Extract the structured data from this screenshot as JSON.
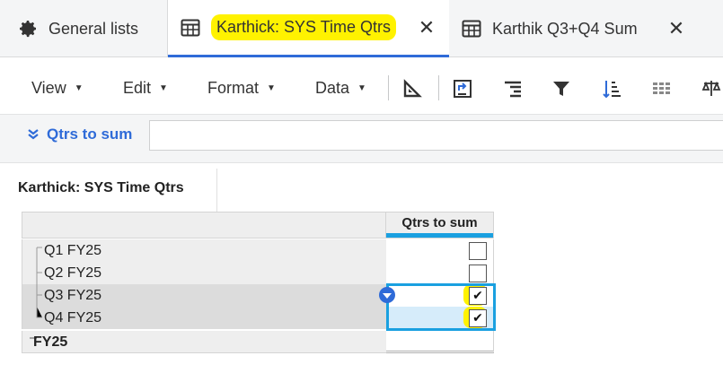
{
  "tabs": [
    {
      "label": "General lists",
      "icon": "gear-icon"
    },
    {
      "label": "Karthick: SYS Time Qtrs",
      "icon": "table-icon",
      "active": true,
      "close": "✕"
    },
    {
      "label": "Karthik Q3+Q4 Sum",
      "icon": "table-icon",
      "close": "✕"
    }
  ],
  "toolbar": {
    "menus": [
      "View",
      "Edit",
      "Format",
      "Data"
    ],
    "icons": [
      "ruler-icon",
      "pivot-icon",
      "align-icon",
      "filter-icon",
      "sort-icon",
      "grid-icon",
      "balance-icon"
    ]
  },
  "filter": {
    "label": "Qtrs to sum",
    "value": ""
  },
  "sheet": {
    "title": "Karthick: SYS Time Qtrs"
  },
  "grid": {
    "column_header": "Qtrs to sum",
    "rows": [
      {
        "label": "Q1 FY25",
        "checked": false,
        "bold": false
      },
      {
        "label": "Q2 FY25",
        "checked": false,
        "bold": false
      },
      {
        "label": "Q3 FY25",
        "checked": true,
        "bold": false
      },
      {
        "label": "Q4 FY25",
        "checked": true,
        "bold": false
      },
      {
        "label": "FY25",
        "checked": null,
        "bold": true
      }
    ]
  },
  "colors": {
    "accent": "#2f6bd8",
    "highlight": "#fff200",
    "selection": "#1aa0e0"
  }
}
